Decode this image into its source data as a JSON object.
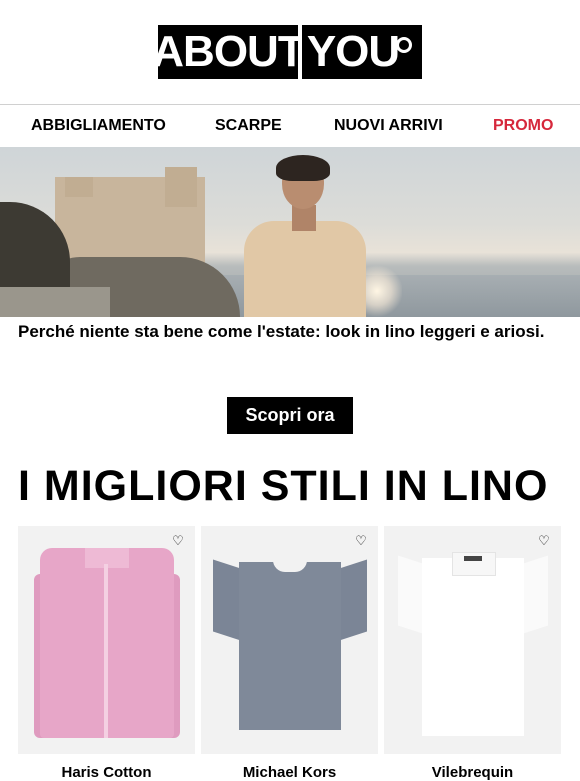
{
  "brand": {
    "logo_left": "ABOUT",
    "logo_right": "YOU"
  },
  "nav": {
    "items": [
      "ABBIGLIAMENTO",
      "SCARPE",
      "NUOVI ARRIVI",
      "PROMO"
    ]
  },
  "hero": {
    "caption": "Perché niente sta bene come l'estate: look in lino leggeri e ariosi.",
    "cta_label": "Scopri ora"
  },
  "section": {
    "title": "I MIGLIORI STILI IN LINO"
  },
  "products": [
    {
      "brand": "Haris Cotton",
      "icon": "heart-icon"
    },
    {
      "brand": "Michael Kors",
      "icon": "heart-icon"
    },
    {
      "brand": "Vilebrequin",
      "icon": "heart-icon"
    }
  ],
  "colors": {
    "promo": "#d6283c",
    "primary": "#000000",
    "card_bg": "#f2f2f2"
  }
}
